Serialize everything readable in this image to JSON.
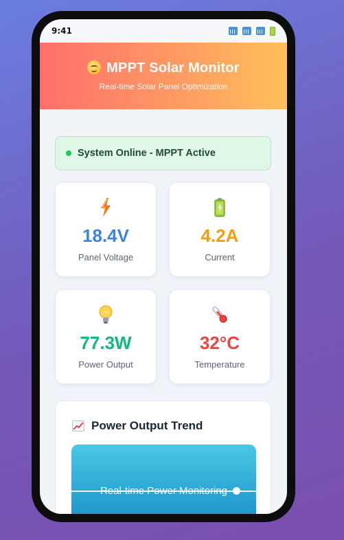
{
  "statusbar": {
    "time": "9:41"
  },
  "header": {
    "title": "MPPT Solar Monitor",
    "subtitle": "Real-time Solar Panel Optimization"
  },
  "system_status": {
    "text": "System Online - MPPT Active",
    "color": "#22c55e"
  },
  "metrics": [
    {
      "icon": "lightning-icon",
      "value": "18.4V",
      "label": "Panel Voltage",
      "color": "#3b82e6"
    },
    {
      "icon": "battery-icon",
      "value": "4.2A",
      "label": "Current",
      "color": "#f59e0b"
    },
    {
      "icon": "lightbulb-icon",
      "value": "77.3W",
      "label": "Power Output",
      "color": "#10b981"
    },
    {
      "icon": "thermometer-icon",
      "value": "32°C",
      "label": "Temperature",
      "color": "#ef4444"
    }
  ],
  "trend": {
    "title": "Power Output Trend",
    "chart_label": "Real-time Power Monitoring"
  }
}
